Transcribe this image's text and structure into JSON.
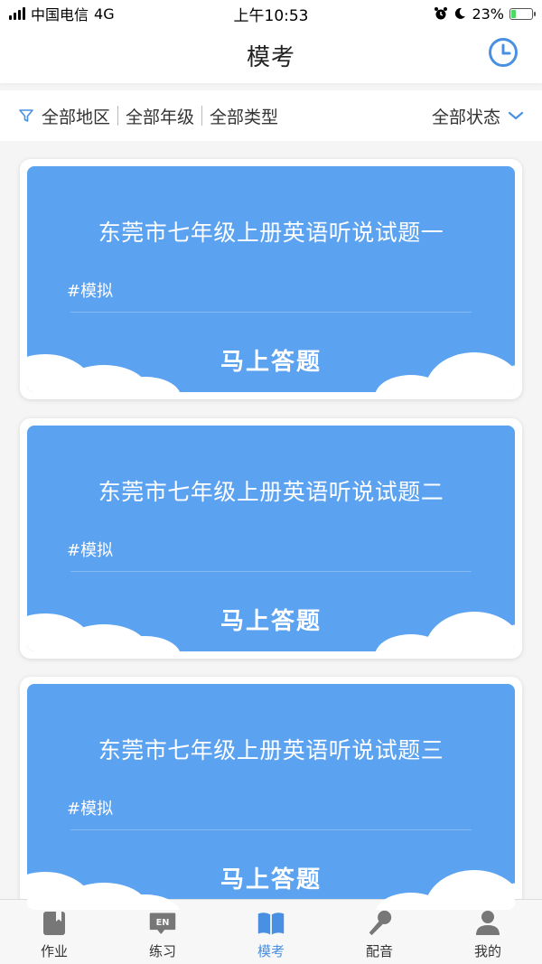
{
  "status_bar": {
    "carrier": "中国电信",
    "network": "4G",
    "time": "上午10:53",
    "battery": "23%",
    "battery_level": 0.23
  },
  "header": {
    "title": "模考",
    "history_icon": "clock-icon"
  },
  "filters": {
    "region": "全部地区",
    "grade": "全部年级",
    "type": "全部类型",
    "status": "全部状态",
    "filter_icon": "funnel-icon"
  },
  "cards": [
    {
      "title": "东莞市七年级上册英语听说试题一",
      "tag": "#模拟",
      "action": "马上答题"
    },
    {
      "title": "东莞市七年级上册英语听说试题二",
      "tag": "#模拟",
      "action": "马上答题"
    },
    {
      "title": "东莞市七年级上册英语听说试题三",
      "tag": "#模拟",
      "action": "马上答题"
    }
  ],
  "tab_bar": {
    "items": [
      {
        "label": "作业",
        "icon": "bookmark-icon",
        "active": false
      },
      {
        "label": "练习",
        "icon": "en-icon",
        "active": false
      },
      {
        "label": "模考",
        "icon": "book-icon",
        "active": true
      },
      {
        "label": "配音",
        "icon": "microphone-icon",
        "active": false
      },
      {
        "label": "我的",
        "icon": "user-icon",
        "active": false
      }
    ]
  },
  "colors": {
    "accent": "#4a90e2",
    "card_blue": "#5ba2f0"
  }
}
